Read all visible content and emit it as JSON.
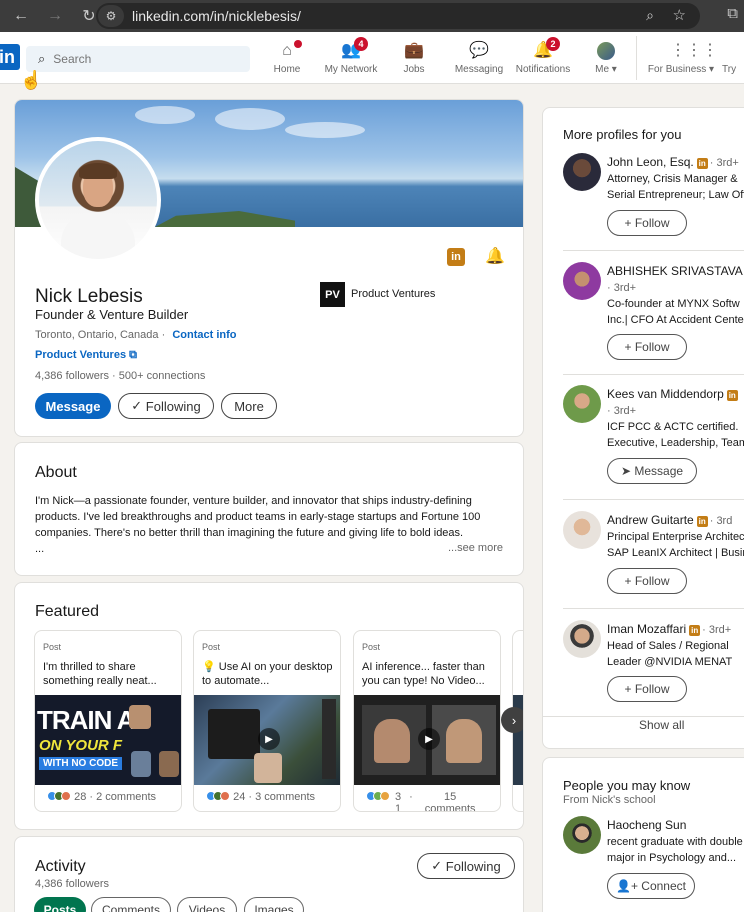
{
  "browser": {
    "url": "linkedin.com/in/nicklebesis/"
  },
  "nav": {
    "search_placeholder": "Search",
    "logo": "in",
    "items": [
      {
        "label": "Home",
        "icon": "home-icon",
        "badge": ""
      },
      {
        "label": "My Network",
        "icon": "network-icon",
        "badge": "4"
      },
      {
        "label": "Jobs",
        "icon": "briefcase-icon",
        "badge": ""
      },
      {
        "label": "Messaging",
        "icon": "chat-icon",
        "badge": ""
      },
      {
        "label": "Notifications",
        "icon": "bell-icon",
        "badge": "2"
      },
      {
        "label": "Me ▾",
        "icon": "avatar",
        "badge": ""
      },
      {
        "label": "For Business ▾",
        "icon": "grid-icon",
        "badge": ""
      },
      {
        "label": "Try",
        "icon": "",
        "badge": ""
      }
    ]
  },
  "profile": {
    "name": "Nick Lebesis",
    "headline": "Founder & Venture Builder",
    "location": "Toronto, Ontario, Canada",
    "location_sep": " · ",
    "contact_info": "Contact info",
    "company_link": "Product Ventures",
    "followers": "4,386 followers",
    "connections": "500+ connections",
    "buttons": {
      "message": "Message",
      "following": "Following",
      "more": "More"
    },
    "current_company": {
      "logo_text": "PV",
      "name": "Product Ventures"
    }
  },
  "about": {
    "title": "About",
    "text": "I'm Nick—a passionate founder, venture builder, and innovator that ships industry-defining products. I've led breakthroughs and product teams in early-stage startups and Fortune 100 companies. There's no better thrill than imagining the future and giving life to bold ideas.",
    "ellipsis": "...",
    "see_more": "...see more"
  },
  "featured": {
    "title": "Featured",
    "items": [
      {
        "tag": "Post",
        "text": "I'm thrilled to share something really neat...",
        "image_text_1": "TRAIN AI",
        "image_text_2": "ON YOUR F",
        "image_text_3": "WITH NO CODE",
        "reactions": "28 · 2 comments"
      },
      {
        "tag": "Post",
        "text": "💡 Use AI on your desktop to automate...",
        "reactions": "24 · 3 comments"
      },
      {
        "tag": "Post",
        "text": "AI inference... faster than you can type! No Video...",
        "reactions_count": "3",
        "reactions_sub": "1",
        "comments_count": "15",
        "comments_label": "comments"
      }
    ]
  },
  "activity": {
    "title": "Activity",
    "followers": "4,386 followers",
    "following_button": "Following",
    "tabs": [
      "Posts",
      "Comments",
      "Videos",
      "Images"
    ]
  },
  "more_profiles": {
    "title": "More profiles for you",
    "items": [
      {
        "name": "John Leon, Esq.",
        "degree": "· 3rd+",
        "line1": "Attorney, Crisis Manager &",
        "line2": "Serial Entrepreneur; Law Off",
        "button": "Follow"
      },
      {
        "name": "ABHISHEK SRIVASTAVA",
        "degree": "· 3rd+",
        "line1": "Co-founder at MYNX Softw",
        "line2": "Inc.| CFO At Accident Center",
        "button": "Follow"
      },
      {
        "name": "Kees van Middendorp",
        "degree": "· 3rd+",
        "line1": "ICF PCC & ACTC certified.",
        "line2": "Executive, Leadership, Team",
        "button": "Message"
      },
      {
        "name": "Andrew Guitarte",
        "degree": "· 3rd",
        "line1": "Principal Enterprise Architect",
        "line2": "SAP LeanIX Architect | Busin",
        "button": "Follow"
      },
      {
        "name": "Iman Mozaffari",
        "degree": "· 3rd+",
        "line1": "Head of Sales / Regional",
        "line2": "Leader @NVIDIA MENAT",
        "button": "Follow"
      }
    ],
    "show_all": "Show all"
  },
  "pymk": {
    "title": "People you may know",
    "subtitle": "From Nick's school",
    "person": {
      "name": "Haocheng Sun",
      "line1": "recent graduate with double",
      "line2": "major in Psychology and...",
      "button": "Connect"
    }
  },
  "colors": {
    "linkedin_blue": "#0a66c2",
    "premium_gold": "#c37d16",
    "active_green": "#01754f",
    "badge_red": "#cb112d"
  }
}
